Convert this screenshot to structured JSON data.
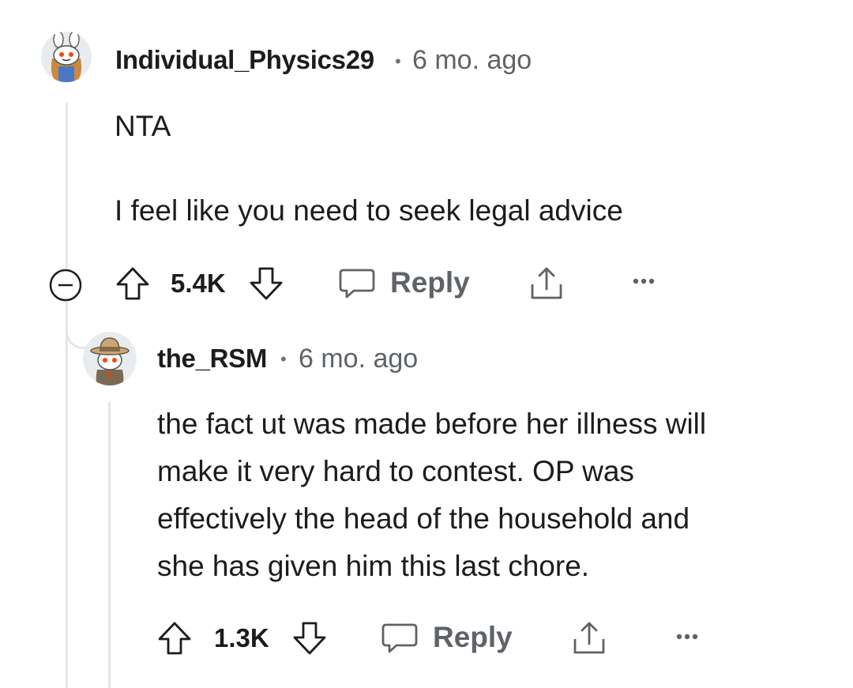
{
  "comments": [
    {
      "username": "Individual_Physics29",
      "separator": "•",
      "time": "6 mo. ago",
      "paragraphs": [
        "NTA",
        "I feel like you need to seek legal advice"
      ],
      "score": "5.4K",
      "reply_label": "Reply",
      "avatar_icon": "bunny-snoo-avatar"
    },
    {
      "username": "the_RSM",
      "separator": "•",
      "time": "6 mo. ago",
      "lines": [
        "the fact ut was made before her illness will",
        "make it very hard to contest. OP was",
        "effectively the head of the household and",
        "she has given him this last chore."
      ],
      "score": "1.3K",
      "reply_label": "Reply",
      "avatar_icon": "cowboy-snoo-avatar"
    }
  ],
  "colors": {
    "text": "#1c1c1c",
    "meta": "#5f6368",
    "thread_line": "#e4e6e8",
    "snoo_eye": "#ff4500"
  }
}
